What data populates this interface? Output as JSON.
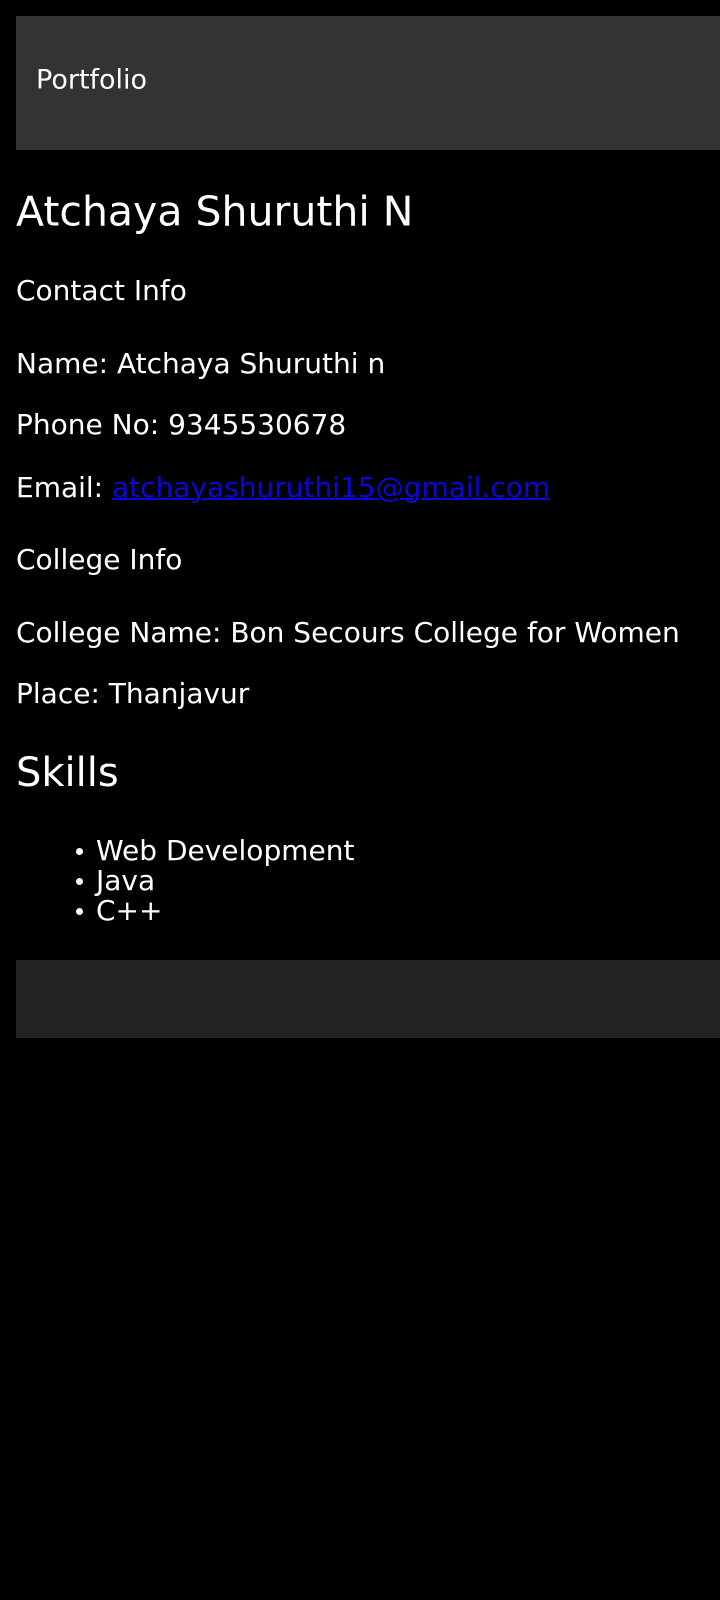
{
  "header": {
    "title": "Portfolio"
  },
  "profile": {
    "name": "Atchaya Shuruthi N"
  },
  "contact": {
    "heading": "Contact Info",
    "name_label": "Name:",
    "name_value": "Atchaya Shuruthi n",
    "phone_label": "Phone No:",
    "phone_value": "9345530678",
    "email_label": "Email:",
    "email_value": "atchayashuruthi15@gmail.com"
  },
  "college": {
    "heading": "College Info",
    "name_label": "College Name:",
    "name_value": "Bon Secours College for Women",
    "place_label": "Place:",
    "place_value": "Thanjavur"
  },
  "skills": {
    "heading": "Skills",
    "items": [
      "Web Development",
      "Java",
      "C++"
    ]
  },
  "colors": {
    "background": "#000000",
    "header_bg": "#333333",
    "footer_bg": "#242424",
    "text": "#ffffff",
    "link": "#0d06d9"
  }
}
